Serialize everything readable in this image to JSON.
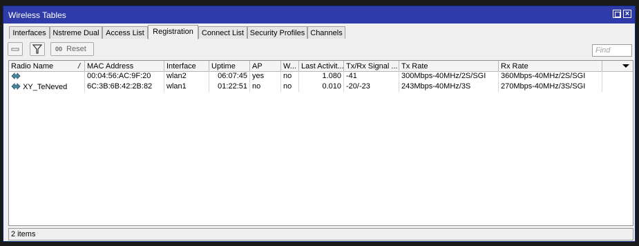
{
  "window": {
    "title": "Wireless Tables"
  },
  "tabs": [
    {
      "label": "Interfaces"
    },
    {
      "label": "Nstreme Dual"
    },
    {
      "label": "Access List"
    },
    {
      "label": "Registration",
      "active": true
    },
    {
      "label": "Connect List"
    },
    {
      "label": "Security Profiles"
    },
    {
      "label": "Channels"
    }
  ],
  "toolbar": {
    "minus_icon": "minus-icon",
    "filter_icon": "filter-icon",
    "reset_prefix": "00",
    "reset_label": "Reset",
    "find_placeholder": "Find"
  },
  "table": {
    "columns": [
      "Radio Name",
      "MAC Address",
      "Interface",
      "Uptime",
      "AP",
      "W...",
      "Last Activit...",
      "Tx/Rx Signal ...",
      "Tx Rate",
      "Rx Rate"
    ],
    "sort_marker": "/",
    "rows": [
      {
        "radio_name": "",
        "mac": "00:04:56:AC:9F:20",
        "interface": "wlan2",
        "uptime": "06:07:45",
        "ap": "yes",
        "w": "no",
        "last_activity": "1.080",
        "signal": "-41",
        "tx_rate": "300Mbps-40MHz/2S/SGI",
        "rx_rate": "360Mbps-40MHz/2S/SGI"
      },
      {
        "radio_name": "XY_TeNeved",
        "mac": "6C:3B:6B:42:2B:82",
        "interface": "wlan1",
        "uptime": "01:22:51",
        "ap": "no",
        "w": "no",
        "last_activity": "0.010",
        "signal": "-20/-23",
        "tx_rate": "243Mbps-40MHz/3S",
        "rx_rate": "270Mbps-40MHz/3S/SGI"
      }
    ]
  },
  "status": {
    "text": "2 items"
  },
  "colors": {
    "titlebar": "#2f3ba8",
    "background": "#f0f0f0"
  }
}
